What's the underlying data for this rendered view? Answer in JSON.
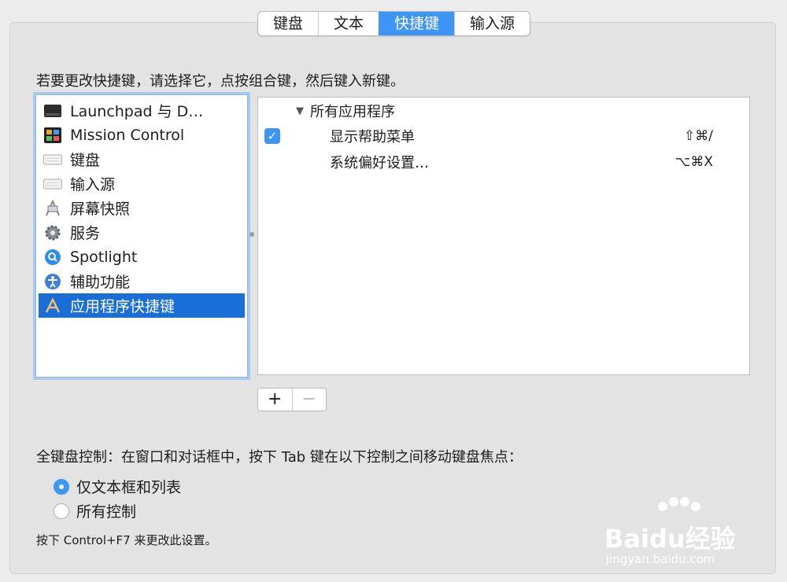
{
  "tabs": [
    {
      "label": "键盘",
      "active": false
    },
    {
      "label": "文本",
      "active": false
    },
    {
      "label": "快捷键",
      "active": true
    },
    {
      "label": "输入源",
      "active": false
    }
  ],
  "instruction": "若要更改快捷键，请选择它，点按组合键，然后键入新键。",
  "categories": [
    {
      "label": "Launchpad 与 D…",
      "icon": "launchpad-icon"
    },
    {
      "label": "Mission Control",
      "icon": "mission-control-icon"
    },
    {
      "label": "键盘",
      "icon": "keyboard-icon"
    },
    {
      "label": "输入源",
      "icon": "input-source-icon"
    },
    {
      "label": "屏幕快照",
      "icon": "screenshot-icon"
    },
    {
      "label": "服务",
      "icon": "gear-icon"
    },
    {
      "label": "Spotlight",
      "icon": "spotlight-icon"
    },
    {
      "label": "辅助功能",
      "icon": "accessibility-icon"
    },
    {
      "label": "应用程序快捷键",
      "icon": "app-store-icon",
      "selected": true
    }
  ],
  "shortcuts": {
    "group_label": "所有应用程序",
    "items": [
      {
        "label": "显示帮助菜单",
        "key": "⇧⌘/",
        "checked": true
      },
      {
        "label": "系统偏好设置…",
        "key": "⌥⌘X",
        "checked": false
      }
    ]
  },
  "buttons": {
    "add": "+",
    "remove": "−"
  },
  "keyboard_control": {
    "title": "全键盘控制：在窗口和对话框中，按下 Tab 键在以下控制之间移动键盘焦点：",
    "options": [
      {
        "label": "仅文本框和列表",
        "selected": true
      },
      {
        "label": "所有控制",
        "selected": false
      }
    ],
    "footnote": "按下 Control+F7 来更改此设置。"
  },
  "watermark": {
    "text": "Baidu经验",
    "sub": "jingyan.baidu.com"
  },
  "colors": {
    "accent": "#3d95f5",
    "selection": "#1a6ed8"
  }
}
